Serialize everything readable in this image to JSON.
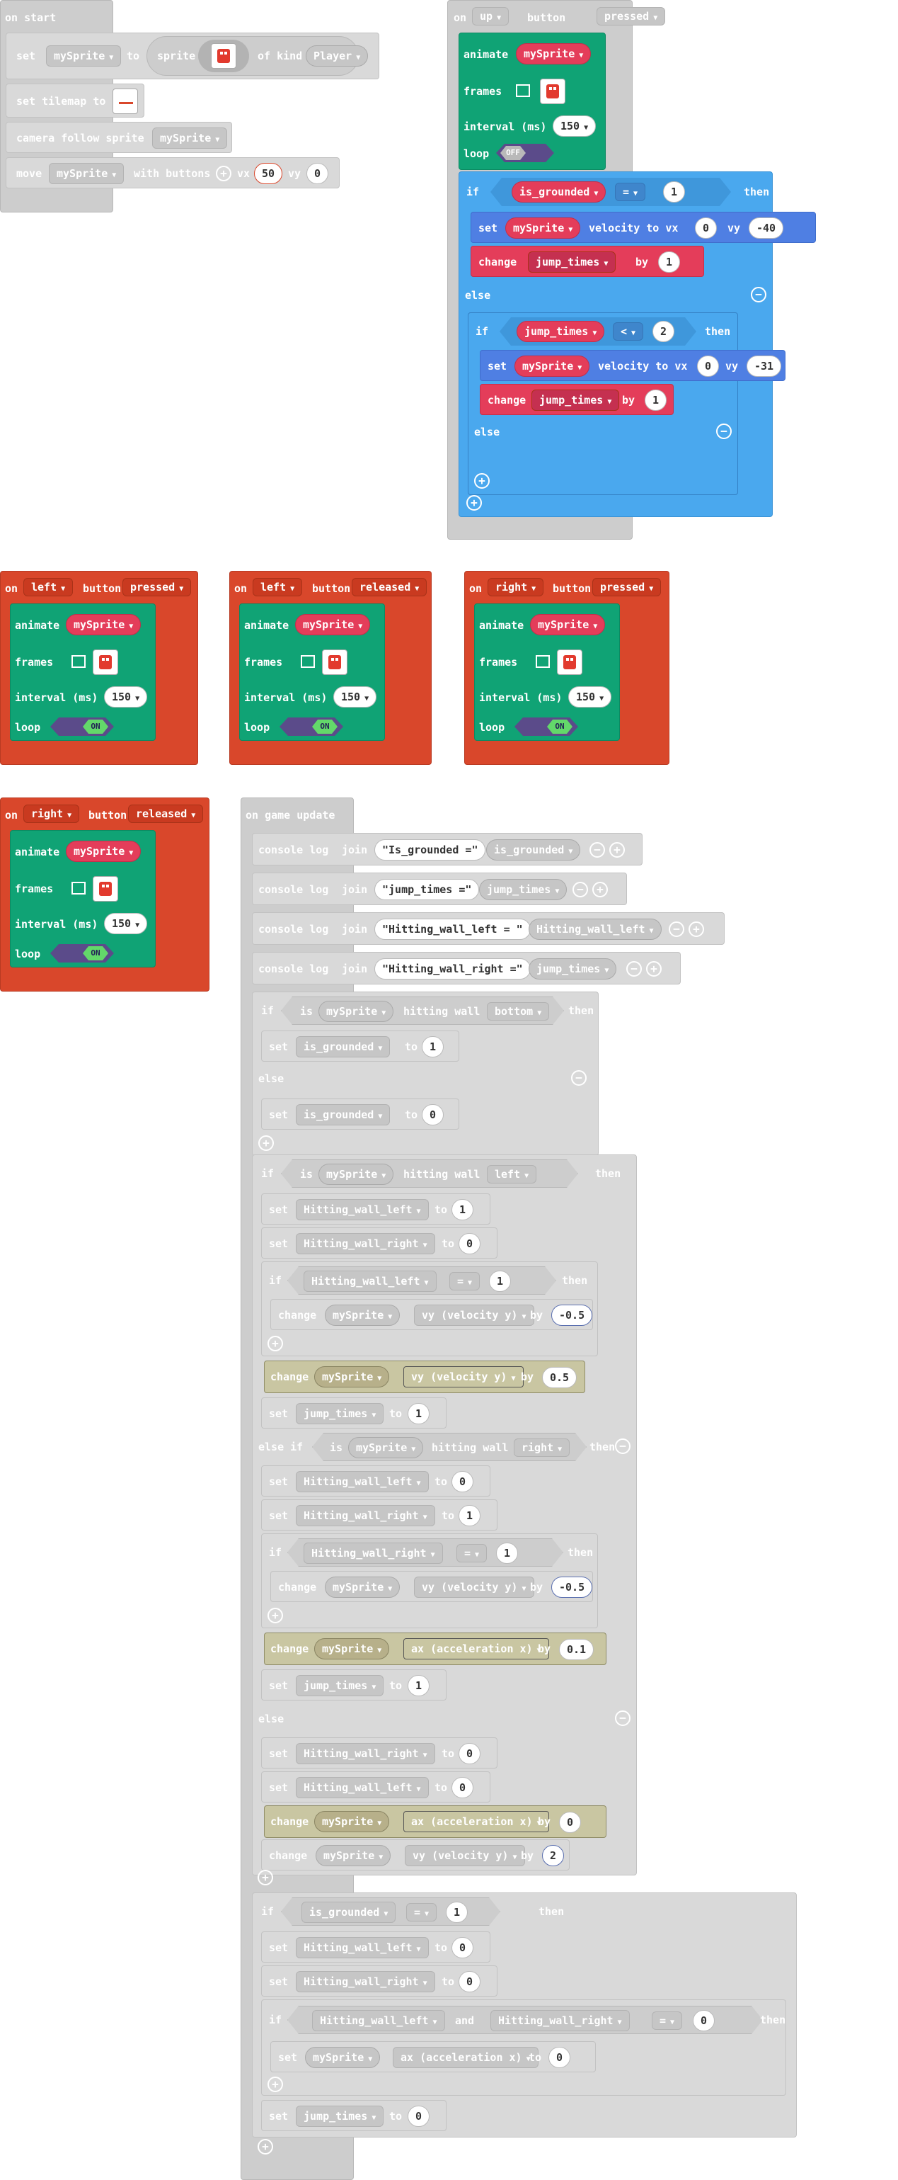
{
  "common": {
    "set": "set",
    "to": "to",
    "if": "if",
    "then": "then",
    "else": "else",
    "else_if": "else if",
    "change": "change",
    "by": "by",
    "console_log": "console log",
    "join": "join",
    "is": "is",
    "hitting_wall": "hitting wall",
    "animate": "animate",
    "frames": "frames",
    "interval": "interval (ms)",
    "loop": "loop",
    "on": "on",
    "button": "button",
    "on_label": "ON",
    "off_label": "OFF",
    "velocity_to_vx": "velocity to vx",
    "vy": "vy",
    "vx": "vx",
    "and": "and",
    "eq": "=",
    "lt": "<"
  },
  "vars": {
    "mySprite": "mySprite",
    "is_grounded": "is_grounded",
    "jump_times": "jump_times",
    "hitting_wall_left": "Hitting_wall_left",
    "hitting_wall_right": "Hitting_wall_right"
  },
  "props": {
    "vy_velocity": "vy (velocity y)",
    "ax_accel": "ax (acceleration x)"
  },
  "on_start": {
    "header": "on start",
    "set_sprite_to": "sprite",
    "of_kind": "of kind",
    "kind": "Player",
    "set_tilemap": "set tilemap to",
    "camera": "camera follow sprite",
    "move": "move",
    "with_buttons": "with buttons",
    "vx_val": "50",
    "vy_val": "0"
  },
  "on_up": {
    "button": "up",
    "event": "pressed",
    "interval": "150",
    "cond_val": "1",
    "vx1": "0",
    "vy1": "-40",
    "by1": "1",
    "cond2_val": "2",
    "vx2": "0",
    "vy2": "-31",
    "by2": "1"
  },
  "events": [
    {
      "button": "left",
      "event": "pressed",
      "interval": "150"
    },
    {
      "button": "left",
      "event": "released",
      "interval": "150"
    },
    {
      "button": "right",
      "event": "pressed",
      "interval": "150"
    },
    {
      "button": "right",
      "event": "released",
      "interval": "150"
    }
  ],
  "update": {
    "header": "on game update",
    "logs": [
      {
        "str": "Is_grounded =",
        "var": "is_grounded"
      },
      {
        "str": "jump_times =",
        "var": "jump_times"
      },
      {
        "str": "Hitting_wall_left = ",
        "var": "Hitting_wall_left"
      },
      {
        "str": "Hitting_wall_right =",
        "var": "jump_times"
      }
    ],
    "wall_bottom": "bottom",
    "wall_left": "left",
    "wall_right": "right",
    "v1": "1",
    "v0": "0",
    "neg05": "-0.5",
    "pos05": "0.5",
    "pos01": "0.1",
    "two": "2"
  }
}
